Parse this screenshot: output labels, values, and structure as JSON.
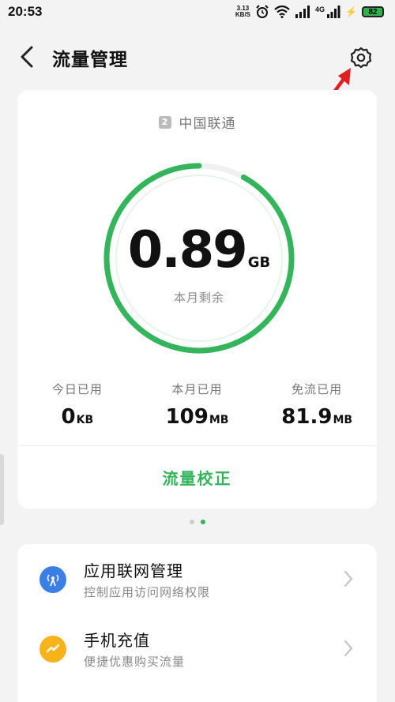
{
  "status_bar": {
    "time": "20:53",
    "net_speed_value": "3.13",
    "net_speed_unit": "KB/S",
    "network_label": "4G",
    "battery": "82",
    "icons": [
      "alarm-icon",
      "wifi-icon",
      "signal-icon",
      "charging-icon"
    ]
  },
  "header": {
    "title": "流量管理",
    "back_icon": "chevron-left-icon",
    "settings_icon": "gear-icon"
  },
  "usage_card": {
    "sim_slot": "2",
    "carrier": "中国联通",
    "remaining": {
      "value": "0.89",
      "unit": "GB",
      "label": "本月剩余",
      "fraction_remaining": 0.92
    },
    "stats": [
      {
        "label": "今日已用",
        "value": "0",
        "unit": "KB"
      },
      {
        "label": "本月已用",
        "value": "109",
        "unit": "MB"
      },
      {
        "label": "免流已用",
        "value": "81.9",
        "unit": "MB"
      }
    ],
    "calibrate_label": "流量校正"
  },
  "pagination": {
    "count": 2,
    "active_index": 1
  },
  "list": [
    {
      "title": "应用联网管理",
      "subtitle": "控制应用访问网络权限",
      "icon": "antenna-icon",
      "color": "#3a7ee6"
    },
    {
      "title": "手机充值",
      "subtitle": "便捷优惠购买流量",
      "icon": "lightning-icon",
      "color": "#f6b41a"
    }
  ],
  "colors": {
    "accent": "#35b55b",
    "annotation": "#e02020",
    "background": "#f3f3f3"
  }
}
